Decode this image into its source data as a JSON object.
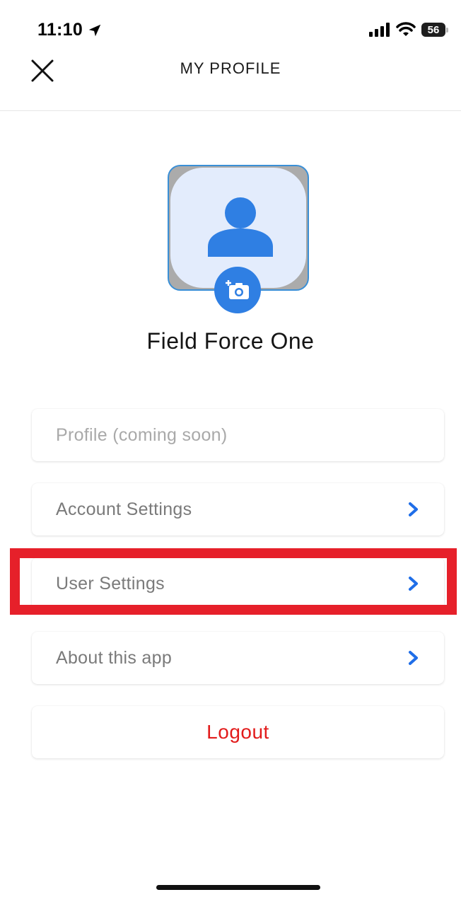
{
  "status_bar": {
    "time": "11:10",
    "battery": "56"
  },
  "header": {
    "title": "MY PROFILE"
  },
  "profile": {
    "name": "Field Force One"
  },
  "menu": {
    "profile_label": "Profile (coming soon)",
    "account_settings_label": "Account Settings",
    "user_settings_label": "User Settings",
    "about_label": "About this app",
    "logout_label": "Logout"
  },
  "colors": {
    "accent": "#2f7fe3",
    "logout": "#e21c1c",
    "highlight": "#e6202a"
  },
  "icons": [
    "location-arrow-icon",
    "signal-icon",
    "wifi-icon",
    "battery-icon",
    "close-icon",
    "person-icon",
    "camera-add-icon",
    "chevron-right-icon"
  ]
}
